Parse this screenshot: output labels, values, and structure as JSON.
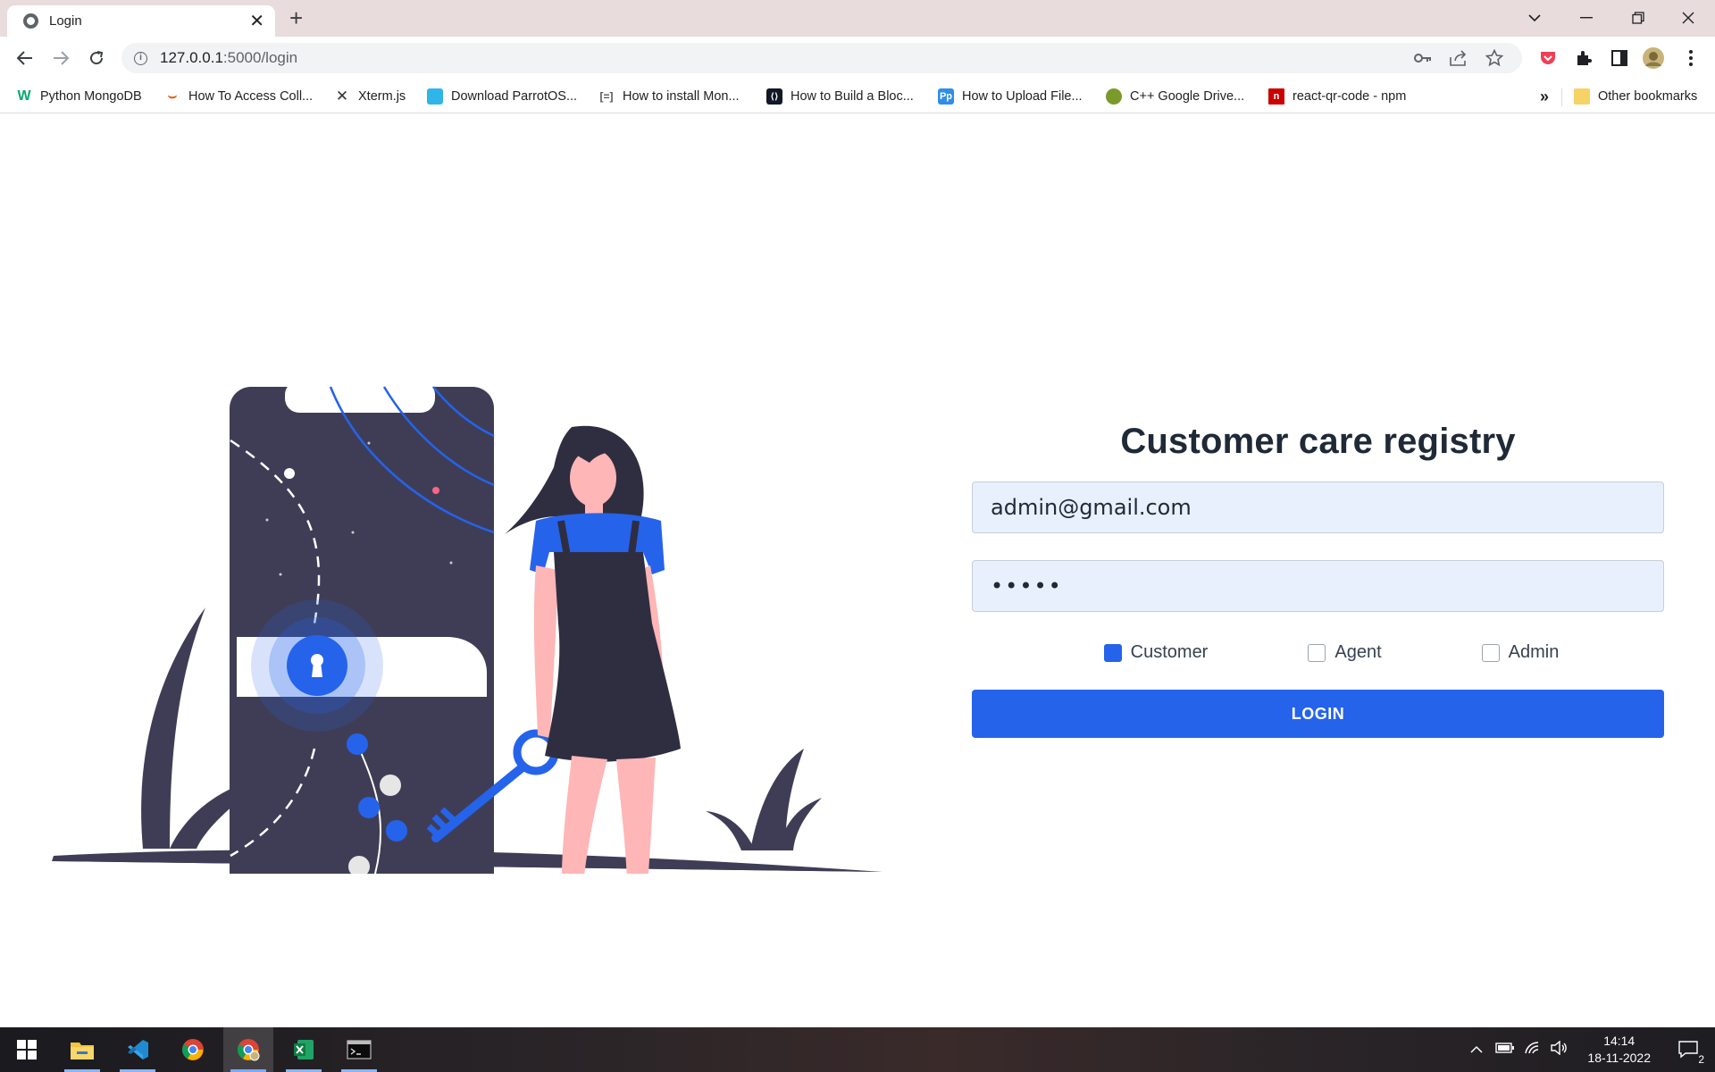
{
  "browser": {
    "tab_title": "Login",
    "url_host": "127.0.0.1",
    "url_rest": ":5000/login",
    "bookmarks": [
      {
        "label": "Python MongoDB",
        "icon": "w3schools-icon",
        "color": "#04aa6d"
      },
      {
        "label": "How To Access Coll...",
        "icon": "swoosh-icon",
        "color": "#e8590c"
      },
      {
        "label": "Xterm.js",
        "icon": "xterm-icon",
        "color": "#333333"
      },
      {
        "label": "Download ParrotOS...",
        "icon": "parrot-icon",
        "color": "#30b5e8"
      },
      {
        "label": "How to install Mon...",
        "icon": "install-icon",
        "color": "#555555"
      },
      {
        "label": "How to Build a Bloc...",
        "icon": "build-icon",
        "color": "#111827"
      },
      {
        "label": "How to Upload File...",
        "icon": "pp-icon",
        "color": "#2f8ee5"
      },
      {
        "label": "C++ Google Drive...",
        "icon": "cpp-icon",
        "color": "#7a9a2c"
      },
      {
        "label": "react-qr-code - npm",
        "icon": "npm-icon",
        "color": "#cb0000"
      }
    ],
    "overflow": "»",
    "other_bookmarks": "Other bookmarks"
  },
  "login": {
    "title": "Customer care registry",
    "email_value": "admin@gmail.com",
    "password_masked": "•••••",
    "roles": [
      {
        "label": "Customer",
        "checked": true
      },
      {
        "label": "Agent",
        "checked": false
      },
      {
        "label": "Admin",
        "checked": false
      }
    ],
    "button_label": "LOGIN"
  },
  "taskbar": {
    "time": "14:14",
    "date": "18-11-2022",
    "notifications": "2"
  },
  "colors": {
    "accent": "#2563eb",
    "illustration_dark": "#3f3d56",
    "illustration_skin": "#ffb6b6"
  }
}
